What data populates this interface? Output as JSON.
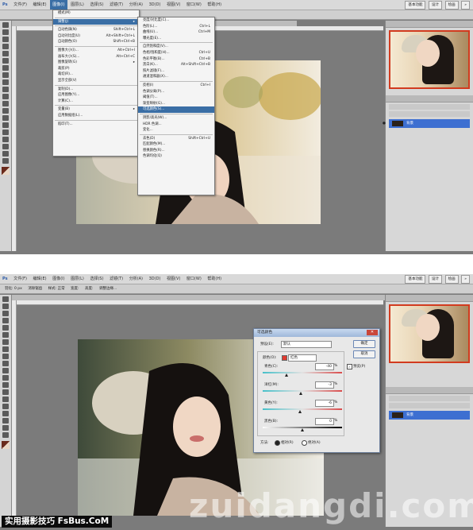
{
  "top_screenshot": {
    "menubar": [
      "文件(F)",
      "编辑(E)",
      "图像(I)",
      "图层(L)",
      "选择(S)",
      "滤镜(T)",
      "分析(A)",
      "3D(D)",
      "视图(V)",
      "窗口(W)",
      "帮助(H)"
    ],
    "workspace_buttons": [
      "基本功能",
      "设计",
      "绘画",
      "»"
    ],
    "image_menu": [
      "模式(M)",
      "调整(J)",
      "自动色调(N)",
      "自动对比度(U)",
      "自动颜色(O)",
      "图像大小(I)...",
      "画布大小(S)...",
      "图像旋转(G)",
      "裁剪(P)",
      "裁切(R)...",
      "显示全部(V)",
      "复制(D)...",
      "应用图像(Y)...",
      "计算(C)...",
      "变量(B)",
      "应用数据组(L)...",
      "陷印(T)..."
    ],
    "image_menu_shortcuts": [
      "",
      "",
      "Shift+Ctrl+L",
      "Alt+Shift+Ctrl+L",
      "Shift+Ctrl+B",
      "Alt+Ctrl+I",
      "Alt+Ctrl+C",
      "",
      "",
      "",
      "",
      "",
      "",
      "",
      "",
      "",
      ""
    ],
    "adjust_menu": [
      "亮度/对比度(C)...",
      "色阶(L)...",
      "曲线(U)...",
      "曝光度(E)...",
      "自然饱和度(V)...",
      "色相/饱和度(H)...",
      "色彩平衡(B)...",
      "黑白(K)...",
      "照片滤镜(F)...",
      "通道混和器(X)...",
      "反相(I)",
      "色调分离(P)...",
      "阈值(T)...",
      "渐变映射(G)...",
      "可选颜色(S)...",
      "阴影/高光(W)...",
      "HDR 色调...",
      "变化...",
      "去色(D)",
      "匹配颜色(M)...",
      "替换颜色(R)...",
      "色调均化(Q)"
    ],
    "adjust_menu_shortcuts": [
      "",
      "Ctrl+L",
      "Ctrl+M",
      "",
      "",
      "Ctrl+U",
      "Ctrl+B",
      "Alt+Shift+Ctrl+B",
      "",
      "",
      "Ctrl+I",
      "",
      "",
      "",
      "",
      "",
      "",
      "",
      "Shift+Ctrl+U",
      "",
      "",
      ""
    ],
    "highlighted_item": "可选颜色(S)...",
    "layer_name": "背景"
  },
  "bottom_screenshot": {
    "menubar": [
      "文件(F)",
      "编辑(E)",
      "图像(I)",
      "图层(L)",
      "选择(S)",
      "滤镜(T)",
      "分析(A)",
      "3D(D)",
      "视图(V)",
      "窗口(W)",
      "帮助(H)"
    ],
    "workspace_buttons": [
      "基本功能",
      "设计",
      "绘画",
      "»"
    ],
    "options_bar": [
      "羽化: 0 px",
      "消除锯齿",
      "样式: 正常",
      "宽度:",
      "高度:",
      "调整边缘..."
    ],
    "dialog": {
      "title": "可选颜色",
      "preset_label": "预设(E):",
      "preset_value": "默认",
      "colors_label": "颜色(O):",
      "colors_value": "红色",
      "ok": "确定",
      "cancel": "取消",
      "preview": "预览(P)",
      "sliders": [
        {
          "label": "青色(C):",
          "value": "-40",
          "unit": "%",
          "level": 0.3
        },
        {
          "label": "洋红(M):",
          "value": "-3",
          "unit": "%",
          "level": 0.48
        },
        {
          "label": "黄色(Y):",
          "value": "-6",
          "unit": "%",
          "level": 0.47
        },
        {
          "label": "黑色(B):",
          "value": "0",
          "unit": "%",
          "level": 0.5
        }
      ],
      "method_label": "方法:",
      "method_relative": "相对(R)",
      "method_absolute": "绝对(A)"
    },
    "layer_name": "背景"
  },
  "footer": {
    "brand": "实用摄影技巧 FsBus.CoM",
    "watermark": "zuidangdi.com"
  },
  "colors": {
    "menu_highlight": "#3a6ea5",
    "layer_selected": "#3d6fd1",
    "workspace_bg": "#7b7b7b"
  }
}
